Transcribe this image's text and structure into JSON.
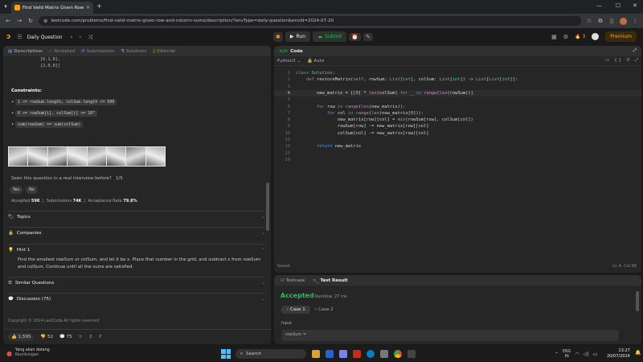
{
  "browser": {
    "tab_title": "Find Valid Matrix Given Row an",
    "url": "leetcode.com/problems/find-valid-matrix-given-row-and-column-sums/description/?envType=daily-question&envId=2024-07-20"
  },
  "lc_top": {
    "title": "Daily Question",
    "run": "Run",
    "submit": "Submit",
    "streak": "3",
    "premium": "Premium"
  },
  "left_tabs": [
    {
      "label": "Description"
    },
    {
      "label": "Accepted"
    },
    {
      "label": "Submissions"
    },
    {
      "label": "Solutions"
    },
    {
      "label": "Editorial"
    }
  ],
  "example_tail": [
    "[6,1,0],",
    "[2,0,0]]"
  ],
  "constraints": {
    "heading": "Constraints:",
    "items": [
      "1 <= rowSum.length, colSum.length <= 500",
      "0 <= rowSum[i], colSum[i] <= 10⁸",
      "sum(rowSum) == sum(colSum)"
    ]
  },
  "interview": {
    "question": "Seen this question in a real interview before?",
    "count": "1/5",
    "yes": "Yes",
    "no": "No"
  },
  "stats": {
    "accepted_label": "Accepted",
    "accepted": "59K",
    "submissions_label": "Submissions",
    "submissions": "74K",
    "rate_label": "Acceptance Rate",
    "rate": "79.8%"
  },
  "sections": {
    "topics": "Topics",
    "companies": "Companies",
    "hint": "Hint 1",
    "hint_text": "Find the smallest rowSum or colSum, and let it be x. Place that number in the grid, and subtract x from rowSum and colSum. Continue until all the sums are satisfied.",
    "similar": "Similar Questions",
    "discussion": "Discussion (75)"
  },
  "copyright": "Copyright © 2024 LeetCode All rights reserved",
  "footer": {
    "likes": "1,595",
    "dislikes": "52",
    "comments": "75"
  },
  "code": {
    "header": "Code",
    "language": "Python3",
    "mode": "Auto",
    "saved": "Saved",
    "cursor": "Ln 4, Col 66",
    "lines": [
      "class Solution:",
      "    def restoreMatrix(self, rowSum: List[int], colSum: List[int]) -> List[List[int]]:",
      "",
      "        new_matrix = [[0] * len(colSum) for _ in range(len(rowSum))]",
      "",
      "        for row in range(len(new_matrix)):",
      "            for col in range(len(new_matrix[0])):",
      "                new_matrix[row][col] = min(rowSum[row], colSum[col])",
      "                rowSum[row] -= new_matrix[row][col]",
      "                colSum[col] -= new_matrix[row][col]",
      "",
      "        return new_matrix",
      "",
      ""
    ],
    "line_numbers": [
      "1",
      "2",
      "3",
      "4",
      "5",
      "6",
      "7",
      "8",
      "9",
      "10",
      "11",
      "12",
      "13",
      "14"
    ]
  },
  "result": {
    "tab_testcase": "Testcase",
    "tab_result": "Test Result",
    "status": "Accepted",
    "runtime": "Runtime: 27 ms",
    "case1": "Case 1",
    "case2": "Case 2",
    "input_label": "Input",
    "input_value": "rowSum ="
  },
  "taskbar": {
    "weather_title": "Yang akan datang",
    "weather_sub": "Keuntungan",
    "search": "Search",
    "lang": "ENG",
    "lang_sub": "IN",
    "time": "13:27",
    "date": "20/07/2024"
  },
  "colors": {
    "accent": "#ffa116",
    "green": "#2cbb5d",
    "panel": "#262626",
    "bg": "#1a1a1a"
  }
}
